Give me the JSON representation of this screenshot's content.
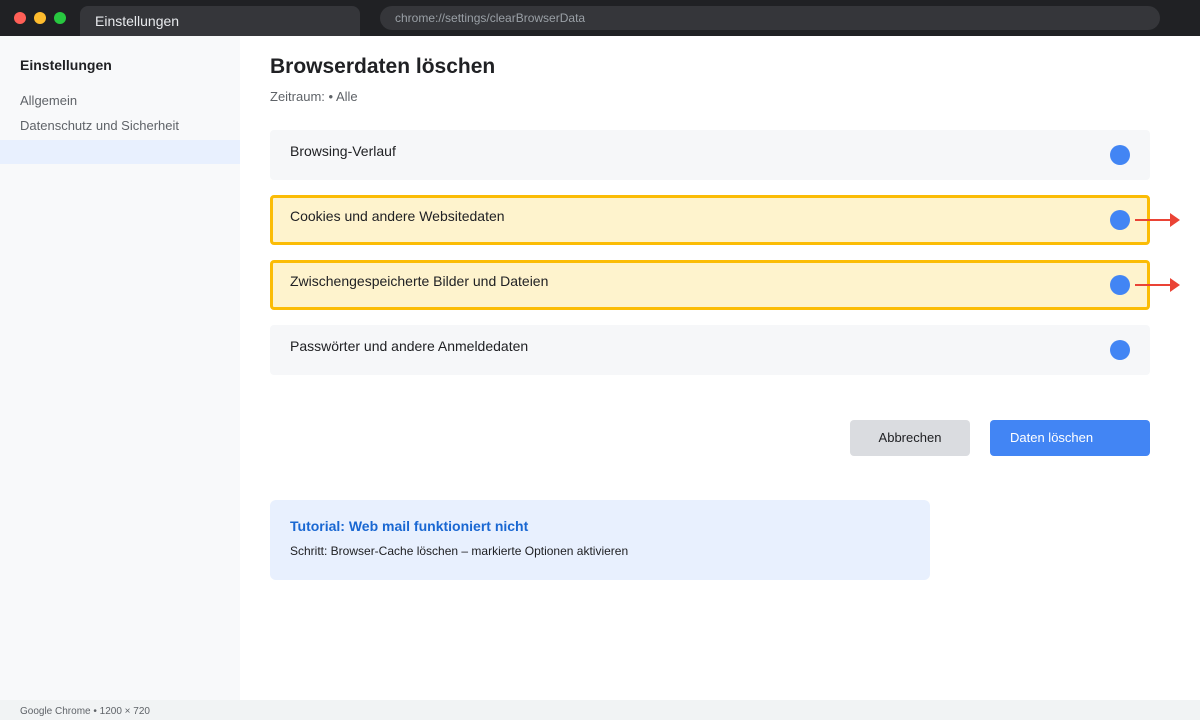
{
  "browser": {
    "tab_title": "Einstellungen",
    "url": "chrome://settings/clearBrowserData",
    "status": "Google Chrome • 1200 × 720"
  },
  "sidebar": {
    "title": "Einstellungen",
    "items": [
      {
        "label": "Allgemein"
      },
      {
        "label": "Datenschutz und Sicherheit"
      }
    ]
  },
  "main": {
    "title": "Browserdaten löschen",
    "subtitle": "Zeitraum: • Alle",
    "options": [
      {
        "label": "Browsing-Verlauf",
        "checked": true,
        "highlighted": false
      },
      {
        "label": "Cookies und andere Websitedaten",
        "checked": true,
        "highlighted": true
      },
      {
        "label": "Zwischengespeicherte Bilder und Dateien",
        "checked": true,
        "highlighted": true
      },
      {
        "label": "Passwörter und andere Anmeldedaten",
        "checked": true,
        "highlighted": false
      }
    ],
    "cancel_label": "Abbrechen",
    "delete_label": "Daten löschen"
  },
  "tutorial": {
    "title": "Tutorial: Web mail funktioniert nicht",
    "text": "Schritt: Browser-Cache löschen – markierte Optionen aktivieren"
  },
  "colors": {
    "accent": "#4285f4",
    "highlight_border": "#fbbc05",
    "highlight_bg": "#fef3cd",
    "arrow": "#ea4335"
  }
}
